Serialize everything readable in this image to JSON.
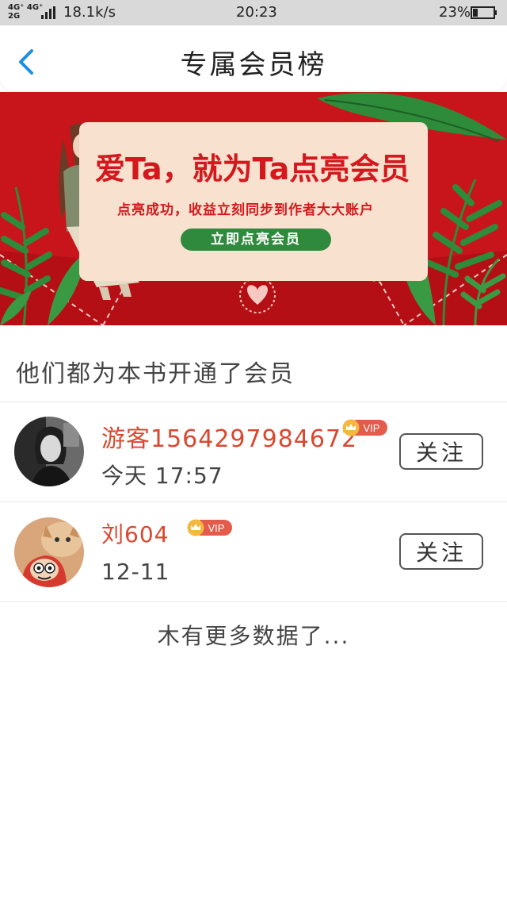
{
  "status_bar": {
    "network": "4G⁺ 4G⁺\n2G",
    "speed": "18.1k/s",
    "time": "20:23",
    "battery": "23%"
  },
  "nav": {
    "title": "专属会员榜"
  },
  "banner": {
    "title": "爱Ta，就为Ta点亮会员",
    "subtitle": "点亮成功，收益立刻同步到作者大大账户",
    "button_label": "立即点亮会员",
    "colors": {
      "background": "#c7151b",
      "card": "#f8e1cf",
      "button": "#2f8a3e",
      "leaf": "#2e8b3a"
    }
  },
  "section": {
    "title": "他们都为本书开通了会员"
  },
  "members": [
    {
      "name": "游客1564297984672",
      "badge": "VIP",
      "time": "今天 17:57",
      "follow_label": "关注"
    },
    {
      "name": "刘604",
      "badge": "VIP",
      "time": "12-11",
      "follow_label": "关注"
    }
  ],
  "footer": {
    "end_text": "木有更多数据了..."
  },
  "accent_color": "#1a8fe3",
  "name_color": "#d9482f"
}
